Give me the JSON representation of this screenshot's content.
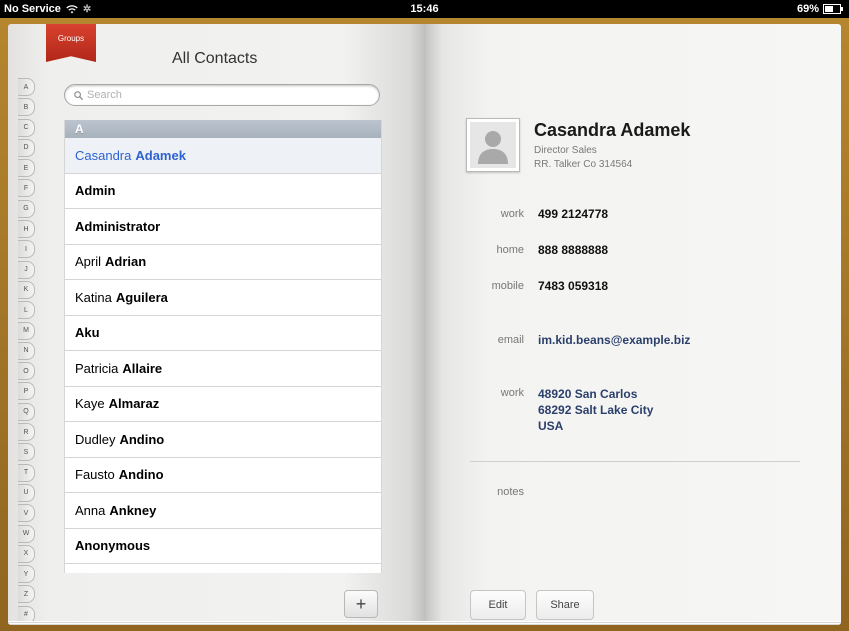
{
  "status_bar": {
    "carrier": "No Service",
    "time": "15:46",
    "battery": "69%",
    "battery_level": 0.69
  },
  "left_page": {
    "groups_label": "Groups",
    "title": "All Contacts",
    "search_placeholder": "Search",
    "index_letters": [
      "A",
      "B",
      "C",
      "D",
      "E",
      "F",
      "G",
      "H",
      "I",
      "J",
      "K",
      "L",
      "M",
      "N",
      "O",
      "P",
      "Q",
      "R",
      "S",
      "T",
      "U",
      "V",
      "W",
      "X",
      "Y",
      "Z",
      "#"
    ],
    "section": "A",
    "contacts": [
      {
        "first": "Casandra",
        "last": "Adamek",
        "selected": true
      },
      {
        "first": "",
        "last": "Admin"
      },
      {
        "first": "",
        "last": "Administrator"
      },
      {
        "first": "April",
        "last": "Adrian"
      },
      {
        "first": "Katina",
        "last": "Aguilera"
      },
      {
        "first": "",
        "last": "Aku"
      },
      {
        "first": "Patricia",
        "last": "Allaire"
      },
      {
        "first": "Kaye",
        "last": "Almaraz"
      },
      {
        "first": "Dudley",
        "last": "Andino"
      },
      {
        "first": "Fausto",
        "last": "Andino"
      },
      {
        "first": "Anna",
        "last": "Ankney"
      },
      {
        "first": "",
        "last": "Anonymous"
      }
    ],
    "add_label": "+"
  },
  "right_page": {
    "name": "Casandra Adamek",
    "title": "Director Sales",
    "company": "RR. Talker Co 314564",
    "phones": [
      {
        "label": "work",
        "value": "499 2124778"
      },
      {
        "label": "home",
        "value": "888 8888888"
      },
      {
        "label": "mobile",
        "value": "7483 059318"
      }
    ],
    "email": {
      "label": "email",
      "value": "im.kid.beans@example.biz"
    },
    "address": {
      "label": "work",
      "line1": "48920 San Carlos",
      "line2": "68292 Salt Lake City",
      "line3": "USA"
    },
    "notes_label": "notes",
    "edit_label": "Edit",
    "share_label": "Share"
  },
  "colors": {
    "accent_blue": "#2d62d1",
    "link_navy": "#2b3f6b",
    "ribbon_red": "#c0301f",
    "book_cover": "#a5782a"
  },
  "icons": [
    "wifi-icon",
    "activity-spinner-icon",
    "battery-icon",
    "search-icon",
    "person-silhouette-icon"
  ]
}
